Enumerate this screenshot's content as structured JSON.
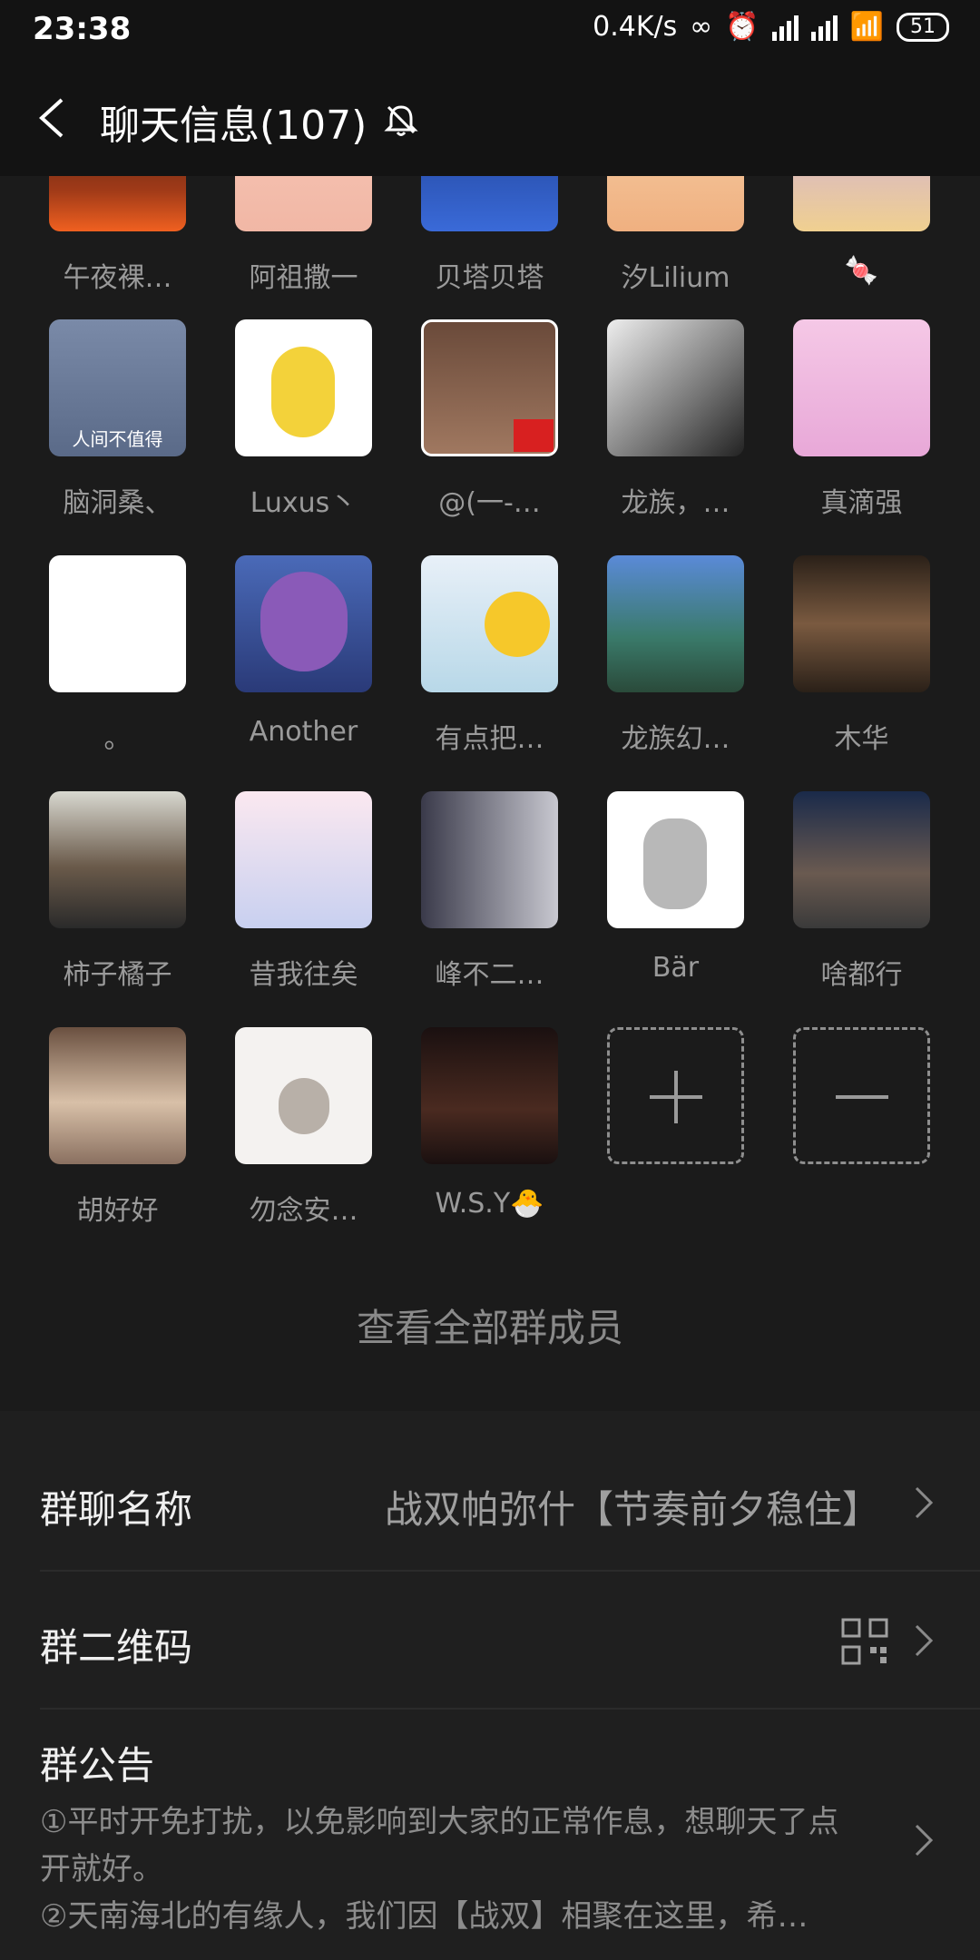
{
  "status": {
    "time": "23:38",
    "speed": "0.4K/s",
    "battery": "51"
  },
  "header": {
    "title": "聊天信息(107)"
  },
  "members": [
    {
      "name": "午夜裸…"
    },
    {
      "name": "阿祖撒一"
    },
    {
      "name": "贝塔贝塔"
    },
    {
      "name": "汐Lilium"
    },
    {
      "name": "🍬"
    },
    {
      "name": "脑洞桑、"
    },
    {
      "name": "Luxus丶"
    },
    {
      "name": "@(一-…"
    },
    {
      "name": "龙族，…"
    },
    {
      "name": "真滴强"
    },
    {
      "name": "。"
    },
    {
      "name": "Another"
    },
    {
      "name": "有点把…"
    },
    {
      "name": "龙族幻…"
    },
    {
      "name": "木华"
    },
    {
      "name": "柿子橘子"
    },
    {
      "name": "昔我往矣"
    },
    {
      "name": "峰不二…"
    },
    {
      "name": "Bär"
    },
    {
      "name": "啥都行"
    },
    {
      "name": "胡好好"
    },
    {
      "name": "勿念安…"
    },
    {
      "name": "W.S.Y🐣"
    }
  ],
  "view_all": "查看全部群成员",
  "group_name": {
    "label": "群聊名称",
    "value": "战双帕弥什【节奏前夕稳住】"
  },
  "qr_row": {
    "label": "群二维码"
  },
  "notice": {
    "label": "群公告",
    "text": "①平时开免打扰，以免影响到大家的正常作息，想聊天了点开就好。\n②天南海北的有缘人，我们因【战双】相聚在这里，希…"
  },
  "avatar_note_text": "人间不值得"
}
